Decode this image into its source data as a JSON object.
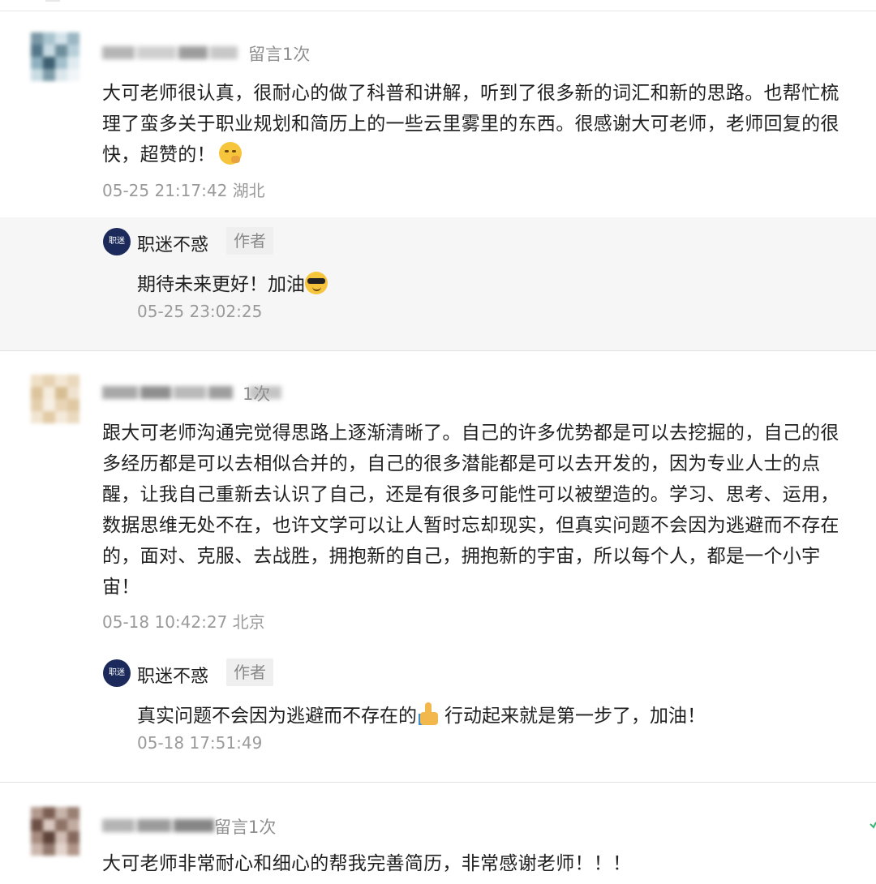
{
  "comments": [
    {
      "count_label": "留言1次",
      "text": "大可老师很认真，很耐心的做了科普和讲解，听到了很多新的词汇和新的思路。也帮忙梳理了蛮多关于职业规划和简历上的一些云里雾里的东西。很感谢大可老师，老师回复的很快，超赞的！",
      "emoji": "shushing-face-emoji",
      "time": "05-25 21:17:42 湖北",
      "reply": {
        "author": "职迷不惑",
        "badge": "作者",
        "text": "期待未来更好！加油",
        "emoji": "sunglasses-face-emoji",
        "time": "05-25 23:02:25"
      }
    },
    {
      "count_label": "1次",
      "text": "跟大可老师沟通完觉得思路上逐渐清晰了。自己的许多优势都是可以去挖掘的，自己的很多经历都是可以去相似合并的，自己的很多潜能都是可以去开发的，因为专业人士的点醒，让我自己重新去认识了自己，还是有很多可能性可以被塑造的。学习、思考、运用，数据思维无处不在，也许文学可以让人暂时忘却现实，但真实问题不会因为逃避而不存在的，面对、克服、去战胜，拥抱新的自己，拥抱新的宇宙，所以每个人，都是一个小宇宙！",
      "time": "05-18 10:42:27 北京",
      "reply": {
        "author": "职迷不惑",
        "badge": "作者",
        "text_before": "真实问题不会因为逃避而不存在的",
        "emoji": "thumbs-up-emoji",
        "text_after": "行动起来就是第一步了，加油！",
        "time": "05-18 17:51:49"
      }
    },
    {
      "count_label": "留言1次",
      "text": "大可老师非常耐心和细心的帮我完善简历，非常感谢老师！！！"
    }
  ],
  "colors": {
    "reply_background": "#f6f6f6",
    "meta_text": "#8f8f8f",
    "author_avatar": "#1b2a5b"
  }
}
